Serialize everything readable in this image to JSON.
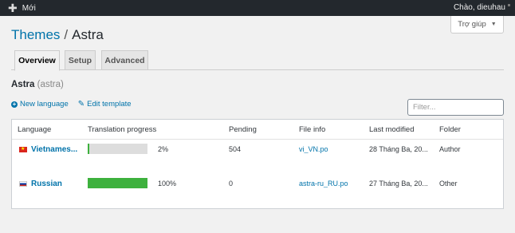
{
  "adminbar": {
    "new_label": "Mới",
    "greeting": "Chào, dieuhau"
  },
  "help": {
    "label": "Trợ giúp"
  },
  "breadcrumb": {
    "parent": "Themes",
    "separator": "/",
    "current": "Astra"
  },
  "tabs": [
    {
      "label": "Overview",
      "active": true
    },
    {
      "label": "Setup",
      "active": false
    },
    {
      "label": "Advanced",
      "active": false
    }
  ],
  "bundle": {
    "name": "Astra",
    "slug": "(astra)"
  },
  "actions": {
    "new_language": "New language",
    "edit_template": "Edit template"
  },
  "filter": {
    "placeholder": "Filter...",
    "value": ""
  },
  "table": {
    "headers": [
      "Language",
      "Translation progress",
      "Pending",
      "File info",
      "Last modified",
      "Folder"
    ],
    "rows": [
      {
        "language": "Vietnames...",
        "flag": "vn-flag-icon",
        "progress_percent": 2,
        "progress_label": "2%",
        "pending": "504",
        "file": "vi_VN.po",
        "modified": "28 Tháng Ba, 20...",
        "folder": "Author"
      },
      {
        "language": "Russian",
        "flag": "ru-flag-icon",
        "progress_percent": 100,
        "progress_label": "100%",
        "pending": "0",
        "file": "astra-ru_RU.po",
        "modified": "27 Tháng Ba, 20...",
        "folder": "Other"
      }
    ]
  },
  "colors": {
    "accent": "#0073aa",
    "progress": "#3db13d",
    "adminbar": "#23282d"
  }
}
